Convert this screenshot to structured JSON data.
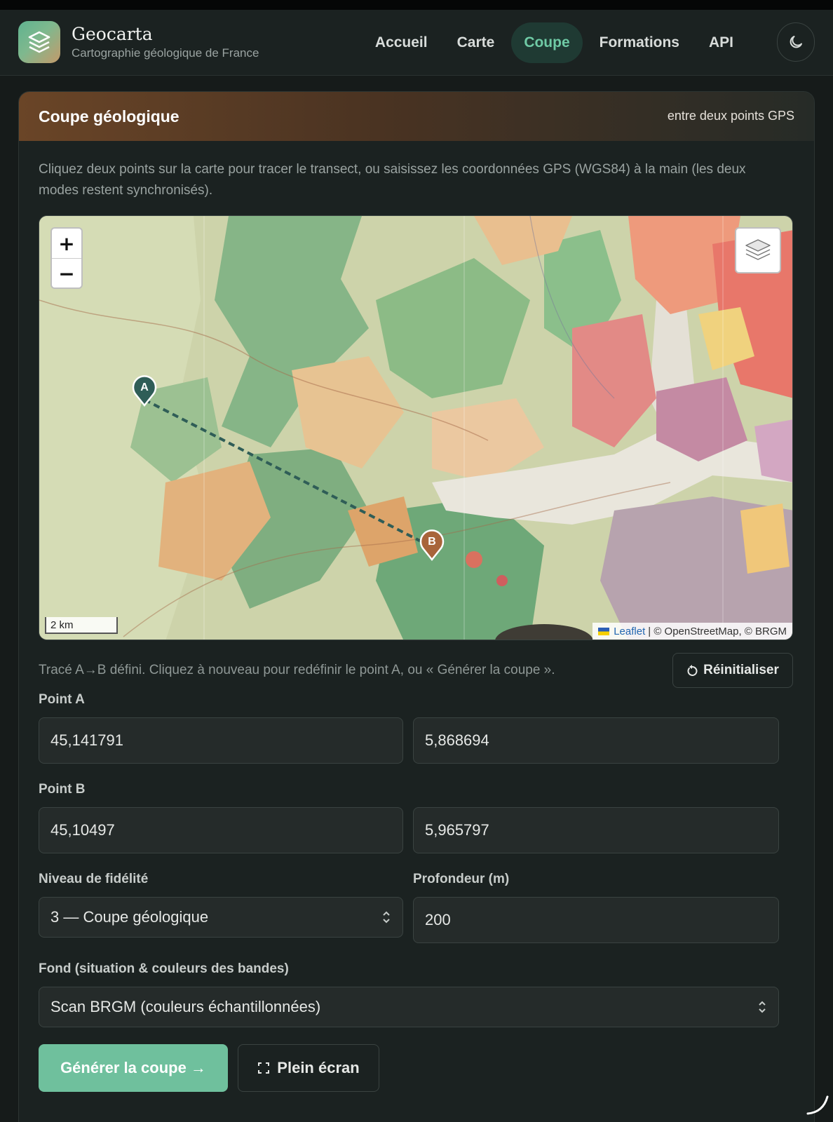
{
  "header": {
    "title": "Geocarta",
    "subtitle": "Cartographie géologique de France",
    "nav": [
      {
        "label": "Accueil",
        "active": false
      },
      {
        "label": "Carte",
        "active": false
      },
      {
        "label": "Coupe",
        "active": true
      },
      {
        "label": "Formations",
        "active": false
      },
      {
        "label": "API",
        "active": false
      }
    ],
    "theme_icon": "moon-icon"
  },
  "card": {
    "title": "Coupe géologique",
    "subtitle": "entre deux points GPS",
    "intro": "Cliquez deux points sur la carte pour tracer le transect, ou saisissez les coordonnées GPS (WGS84) à la main (les deux modes restent synchronisés)."
  },
  "map": {
    "zoom_in": "+",
    "zoom_out": "−",
    "scale": "2 km",
    "attribution_link": "Leaflet",
    "attribution_rest": "| © OpenStreetMap, © BRGM",
    "marker_a": "A",
    "marker_b": "B",
    "colors": {
      "marker_a": "#2f5d57",
      "marker_b": "#a8643a",
      "line": "#2f5d57"
    }
  },
  "status": {
    "text": "Tracé A→B défini. Cliquez à nouveau pour redéfinir le point A, ou « Générer la coupe ».",
    "reset_label": "Réinitialiser"
  },
  "form": {
    "point_a_label": "Point A",
    "point_a_lat": "45,141791",
    "point_a_lon": "5,868694",
    "point_b_label": "Point B",
    "point_b_lat": "45,10497",
    "point_b_lon": "5,965797",
    "fidelity_label": "Niveau de fidélité",
    "fidelity_value": "3 — Coupe géologique",
    "depth_label": "Profondeur (m)",
    "depth_value": "200",
    "background_label": "Fond (situation & couleurs des bandes)",
    "background_value": "Scan BRGM (couleurs échantillonnées)"
  },
  "actions": {
    "generate_label": "Générer la coupe →",
    "fullscreen_label": "Plein écran"
  },
  "colors": {
    "accent": "#6fc09d",
    "header_brown": "#6a4527"
  }
}
